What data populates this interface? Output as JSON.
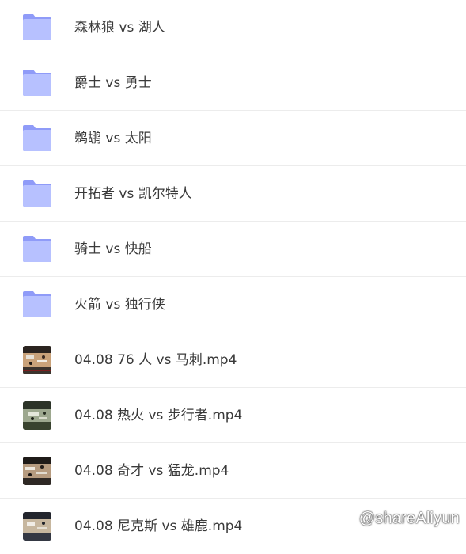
{
  "colors": {
    "folder_back": "#8f9bf8",
    "folder_front": "#b7c1ff",
    "text": "#3a3a3a",
    "divider": "#ececec"
  },
  "items": [
    {
      "type": "folder",
      "icon": "folder-icon",
      "name": "森林狼 vs 湖人"
    },
    {
      "type": "folder",
      "icon": "folder-icon",
      "name": "爵士 vs 勇士"
    },
    {
      "type": "folder",
      "icon": "folder-icon",
      "name": "鹈鹕 vs 太阳"
    },
    {
      "type": "folder",
      "icon": "folder-icon",
      "name": "开拓者 vs 凯尔特人"
    },
    {
      "type": "folder",
      "icon": "folder-icon",
      "name": "骑士 vs 快船"
    },
    {
      "type": "folder",
      "icon": "folder-icon",
      "name": "火箭 vs 独行侠"
    },
    {
      "type": "video",
      "icon": "video-thumbnail",
      "name": "04.08 76 人 vs 马刺.mp4"
    },
    {
      "type": "video",
      "icon": "video-thumbnail",
      "name": "04.08 热火 vs 步行者.mp4"
    },
    {
      "type": "video",
      "icon": "video-thumbnail",
      "name": "04.08 奇才 vs 猛龙.mp4"
    },
    {
      "type": "video",
      "icon": "video-thumbnail",
      "name": "04.08 尼克斯 vs 雄鹿.mp4"
    }
  ],
  "watermark": "@shareAliyun"
}
